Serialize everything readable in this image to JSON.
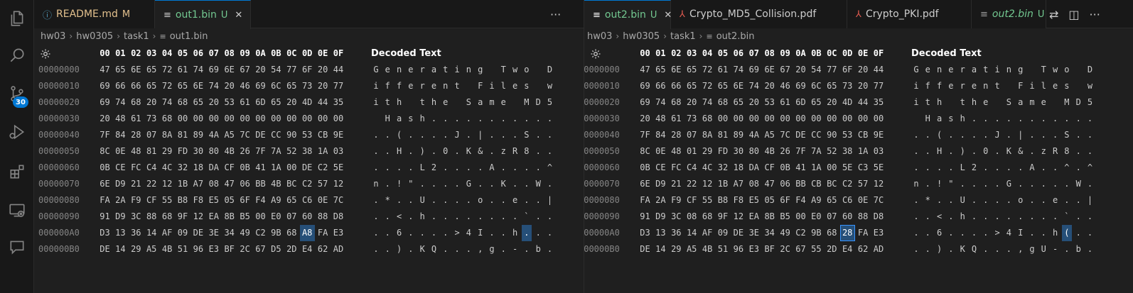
{
  "activity": {
    "icons": [
      "explorer-icon",
      "search-icon",
      "source-control-icon",
      "run-debug-icon",
      "extensions-icon",
      "remote-explorer-icon",
      "comments-icon"
    ],
    "scm_badge": "30"
  },
  "colors": {
    "accent": "#0078d4",
    "selection": "#264f78",
    "modified": "#e2c08d",
    "untracked": "#73c991",
    "pdf": "#e05a50"
  },
  "left": {
    "tabs": [
      {
        "label": "README.md",
        "flag": "M",
        "icon": "info-icon",
        "active": false
      },
      {
        "label": "out1.bin",
        "flag": "U",
        "icon": "binary-file-icon",
        "active": true
      }
    ],
    "more": "···",
    "breadcrumb": [
      "hw03",
      "hw0305",
      "task1",
      "out1.bin"
    ],
    "header": {
      "offsets": [
        "00",
        "01",
        "02",
        "03",
        "04",
        "05",
        "06",
        "07",
        "08",
        "09",
        "0A",
        "0B",
        "0C",
        "0D",
        "0E",
        "0F"
      ],
      "decoded_label": "Decoded Text"
    },
    "rows": [
      {
        "addr": "00000000",
        "bytes": [
          "47",
          "65",
          "6E",
          "65",
          "72",
          "61",
          "74",
          "69",
          "6E",
          "67",
          "20",
          "54",
          "77",
          "6F",
          "20",
          "44"
        ],
        "text": [
          "G",
          "e",
          "n",
          "e",
          "r",
          "a",
          "t",
          "i",
          "n",
          "g",
          " ",
          "T",
          "w",
          "o",
          " ",
          "D"
        ]
      },
      {
        "addr": "00000010",
        "bytes": [
          "69",
          "66",
          "66",
          "65",
          "72",
          "65",
          "6E",
          "74",
          "20",
          "46",
          "69",
          "6C",
          "65",
          "73",
          "20",
          "77"
        ],
        "text": [
          "i",
          "f",
          "f",
          "e",
          "r",
          "e",
          "n",
          "t",
          " ",
          "F",
          "i",
          "l",
          "e",
          "s",
          " ",
          "w"
        ]
      },
      {
        "addr": "00000020",
        "bytes": [
          "69",
          "74",
          "68",
          "20",
          "74",
          "68",
          "65",
          "20",
          "53",
          "61",
          "6D",
          "65",
          "20",
          "4D",
          "44",
          "35"
        ],
        "text": [
          "i",
          "t",
          "h",
          " ",
          "t",
          "h",
          "e",
          " ",
          "S",
          "a",
          "m",
          "e",
          " ",
          "M",
          "D",
          "5"
        ]
      },
      {
        "addr": "00000030",
        "bytes": [
          "20",
          "48",
          "61",
          "73",
          "68",
          "00",
          "00",
          "00",
          "00",
          "00",
          "00",
          "00",
          "00",
          "00",
          "00",
          "00"
        ],
        "text": [
          " ",
          "H",
          "a",
          "s",
          "h",
          ".",
          ".",
          ".",
          ".",
          ".",
          ".",
          ".",
          ".",
          ".",
          ".",
          "."
        ]
      },
      {
        "addr": "00000040",
        "bytes": [
          "7F",
          "84",
          "28",
          "07",
          "8A",
          "81",
          "89",
          "4A",
          "A5",
          "7C",
          "DE",
          "CC",
          "90",
          "53",
          "CB",
          "9E"
        ],
        "text": [
          ".",
          ".",
          "(",
          ".",
          ".",
          ".",
          ".",
          "J",
          ".",
          "|",
          ".",
          ".",
          ".",
          "S",
          ".",
          "."
        ]
      },
      {
        "addr": "00000050",
        "bytes": [
          "8C",
          "0E",
          "48",
          "81",
          "29",
          "FD",
          "30",
          "80",
          "4B",
          "26",
          "7F",
          "7A",
          "52",
          "38",
          "1A",
          "03"
        ],
        "text": [
          ".",
          ".",
          "H",
          ".",
          ")",
          ".",
          "0",
          ".",
          "K",
          "&",
          ".",
          "z",
          "R",
          "8",
          ".",
          "."
        ]
      },
      {
        "addr": "00000060",
        "bytes": [
          "0B",
          "CE",
          "FC",
          "C4",
          "4C",
          "32",
          "18",
          "DA",
          "CF",
          "0B",
          "41",
          "1A",
          "00",
          "DE",
          "C2",
          "5E"
        ],
        "text": [
          ".",
          ".",
          ".",
          ".",
          "L",
          "2",
          ".",
          ".",
          ".",
          ".",
          "A",
          ".",
          ".",
          ".",
          ".",
          "^"
        ]
      },
      {
        "addr": "00000070",
        "bytes": [
          "6E",
          "D9",
          "21",
          "22",
          "12",
          "1B",
          "A7",
          "08",
          "47",
          "06",
          "BB",
          "4B",
          "BC",
          "C2",
          "57",
          "12"
        ],
        "text": [
          "n",
          ".",
          "!",
          "\"",
          ".",
          ".",
          ".",
          ".",
          "G",
          ".",
          ".",
          "K",
          ".",
          ".",
          "W",
          "."
        ]
      },
      {
        "addr": "00000080",
        "bytes": [
          "FA",
          "2A",
          "F9",
          "CF",
          "55",
          "B8",
          "F8",
          "E5",
          "05",
          "6F",
          "F4",
          "A9",
          "65",
          "C6",
          "0E",
          "7C"
        ],
        "text": [
          ".",
          "*",
          ".",
          ".",
          "U",
          ".",
          ".",
          ".",
          ".",
          "o",
          ".",
          ".",
          "e",
          ".",
          ".",
          "|"
        ]
      },
      {
        "addr": "00000090",
        "bytes": [
          "91",
          "D9",
          "3C",
          "88",
          "68",
          "9F",
          "12",
          "EA",
          "8B",
          "B5",
          "00",
          "E0",
          "07",
          "60",
          "88",
          "D8"
        ],
        "text": [
          ".",
          ".",
          "<",
          ".",
          "h",
          ".",
          ".",
          ".",
          ".",
          ".",
          ".",
          ".",
          ".",
          "`",
          ".",
          "."
        ]
      },
      {
        "addr": "000000A0",
        "bytes": [
          "D3",
          "13",
          "36",
          "14",
          "AF",
          "09",
          "DE",
          "3E",
          "34",
          "49",
          "C2",
          "9B",
          "68",
          "A8",
          "FA",
          "E3"
        ],
        "text": [
          ".",
          ".",
          "6",
          ".",
          ".",
          ".",
          ".",
          ">",
          "4",
          "I",
          ".",
          ".",
          "h",
          ".",
          ".",
          "."
        ]
      },
      {
        "addr": "000000B0",
        "bytes": [
          "DE",
          "14",
          "29",
          "A5",
          "4B",
          "51",
          "96",
          "E3",
          "BF",
          "2C",
          "67",
          "D5",
          "2D",
          "E4",
          "62",
          "AD"
        ],
        "text": [
          ".",
          ".",
          ")",
          ".",
          "K",
          "Q",
          ".",
          ".",
          ".",
          ",",
          "g",
          ".",
          "-",
          ".",
          "b",
          "."
        ]
      }
    ],
    "selected": {
      "row": 10,
      "col": 13
    }
  },
  "right": {
    "tabs": [
      {
        "label": "out2.bin",
        "flag": "U",
        "icon": "binary-file-icon",
        "active": true
      },
      {
        "label": "Crypto_MD5_Collision.pdf",
        "flag": "",
        "icon": "pdf-icon",
        "active": false
      },
      {
        "label": "Crypto_PKI.pdf",
        "flag": "",
        "icon": "pdf-icon",
        "active": false
      },
      {
        "label": "out2.bin",
        "flag": "U",
        "icon": "binary-file-icon",
        "active": false
      }
    ],
    "breadcrumb": [
      "hw03",
      "hw0305",
      "task1",
      "out2.bin"
    ],
    "header": {
      "offsets": [
        "00",
        "01",
        "02",
        "03",
        "04",
        "05",
        "06",
        "07",
        "08",
        "09",
        "0A",
        "0B",
        "0C",
        "0D",
        "0E",
        "0F"
      ],
      "decoded_label": "Decoded Text"
    },
    "rows": [
      {
        "addr": "00000000",
        "bytes": [
          "47",
          "65",
          "6E",
          "65",
          "72",
          "61",
          "74",
          "69",
          "6E",
          "67",
          "20",
          "54",
          "77",
          "6F",
          "20",
          "44"
        ],
        "text": [
          "G",
          "e",
          "n",
          "e",
          "r",
          "a",
          "t",
          "i",
          "n",
          "g",
          " ",
          "T",
          "w",
          "o",
          " ",
          "D"
        ]
      },
      {
        "addr": "00000010",
        "bytes": [
          "69",
          "66",
          "66",
          "65",
          "72",
          "65",
          "6E",
          "74",
          "20",
          "46",
          "69",
          "6C",
          "65",
          "73",
          "20",
          "77"
        ],
        "text": [
          "i",
          "f",
          "f",
          "e",
          "r",
          "e",
          "n",
          "t",
          " ",
          "F",
          "i",
          "l",
          "e",
          "s",
          " ",
          "w"
        ]
      },
      {
        "addr": "00000020",
        "bytes": [
          "69",
          "74",
          "68",
          "20",
          "74",
          "68",
          "65",
          "20",
          "53",
          "61",
          "6D",
          "65",
          "20",
          "4D",
          "44",
          "35"
        ],
        "text": [
          "i",
          "t",
          "h",
          " ",
          "t",
          "h",
          "e",
          " ",
          "S",
          "a",
          "m",
          "e",
          " ",
          "M",
          "D",
          "5"
        ]
      },
      {
        "addr": "00000030",
        "bytes": [
          "20",
          "48",
          "61",
          "73",
          "68",
          "00",
          "00",
          "00",
          "00",
          "00",
          "00",
          "00",
          "00",
          "00",
          "00",
          "00"
        ],
        "text": [
          " ",
          "H",
          "a",
          "s",
          "h",
          ".",
          ".",
          ".",
          ".",
          ".",
          ".",
          ".",
          ".",
          ".",
          ".",
          "."
        ]
      },
      {
        "addr": "00000040",
        "bytes": [
          "7F",
          "84",
          "28",
          "07",
          "8A",
          "81",
          "89",
          "4A",
          "A5",
          "7C",
          "DE",
          "CC",
          "90",
          "53",
          "CB",
          "9E"
        ],
        "text": [
          ".",
          ".",
          "(",
          ".",
          ".",
          ".",
          ".",
          "J",
          ".",
          "|",
          ".",
          ".",
          ".",
          "S",
          ".",
          "."
        ]
      },
      {
        "addr": "00000050",
        "bytes": [
          "8C",
          "0E",
          "48",
          "01",
          "29",
          "FD",
          "30",
          "80",
          "4B",
          "26",
          "7F",
          "7A",
          "52",
          "38",
          "1A",
          "03"
        ],
        "text": [
          ".",
          ".",
          "H",
          ".",
          ")",
          ".",
          "0",
          ".",
          "K",
          "&",
          ".",
          "z",
          "R",
          "8",
          ".",
          "."
        ]
      },
      {
        "addr": "00000060",
        "bytes": [
          "0B",
          "CE",
          "FC",
          "C4",
          "4C",
          "32",
          "18",
          "DA",
          "CF",
          "0B",
          "41",
          "1A",
          "00",
          "5E",
          "C3",
          "5E"
        ],
        "text": [
          ".",
          ".",
          ".",
          ".",
          "L",
          "2",
          ".",
          ".",
          ".",
          ".",
          "A",
          ".",
          ".",
          "^",
          ".",
          "^"
        ]
      },
      {
        "addr": "00000070",
        "bytes": [
          "6E",
          "D9",
          "21",
          "22",
          "12",
          "1B",
          "A7",
          "08",
          "47",
          "06",
          "BB",
          "CB",
          "BC",
          "C2",
          "57",
          "12"
        ],
        "text": [
          "n",
          ".",
          "!",
          "\"",
          ".",
          ".",
          ".",
          ".",
          "G",
          ".",
          ".",
          ".",
          ".",
          ".",
          "W",
          "."
        ]
      },
      {
        "addr": "00000080",
        "bytes": [
          "FA",
          "2A",
          "F9",
          "CF",
          "55",
          "B8",
          "F8",
          "E5",
          "05",
          "6F",
          "F4",
          "A9",
          "65",
          "C6",
          "0E",
          "7C"
        ],
        "text": [
          ".",
          "*",
          ".",
          ".",
          "U",
          ".",
          ".",
          ".",
          ".",
          "o",
          ".",
          ".",
          "e",
          ".",
          ".",
          "|"
        ]
      },
      {
        "addr": "00000090",
        "bytes": [
          "91",
          "D9",
          "3C",
          "08",
          "68",
          "9F",
          "12",
          "EA",
          "8B",
          "B5",
          "00",
          "E0",
          "07",
          "60",
          "88",
          "D8"
        ],
        "text": [
          ".",
          ".",
          "<",
          ".",
          "h",
          ".",
          ".",
          ".",
          ".",
          ".",
          ".",
          ".",
          ".",
          "`",
          ".",
          "."
        ]
      },
      {
        "addr": "000000A0",
        "bytes": [
          "D3",
          "13",
          "36",
          "14",
          "AF",
          "09",
          "DE",
          "3E",
          "34",
          "49",
          "C2",
          "9B",
          "68",
          "28",
          "FA",
          "E3"
        ],
        "text": [
          ".",
          ".",
          "6",
          ".",
          ".",
          ".",
          ".",
          ">",
          "4",
          "I",
          ".",
          ".",
          "h",
          "(",
          ".",
          "."
        ]
      },
      {
        "addr": "000000B0",
        "bytes": [
          "DE",
          "14",
          "29",
          "A5",
          "4B",
          "51",
          "96",
          "E3",
          "BF",
          "2C",
          "67",
          "55",
          "2D",
          "E4",
          "62",
          "AD"
        ],
        "text": [
          ".",
          ".",
          ")",
          ".",
          "K",
          "Q",
          ".",
          ".",
          ".",
          ",",
          "g",
          "U",
          "-",
          ".",
          "b",
          "."
        ]
      }
    ],
    "selected": {
      "row": 10,
      "col": 13
    }
  }
}
